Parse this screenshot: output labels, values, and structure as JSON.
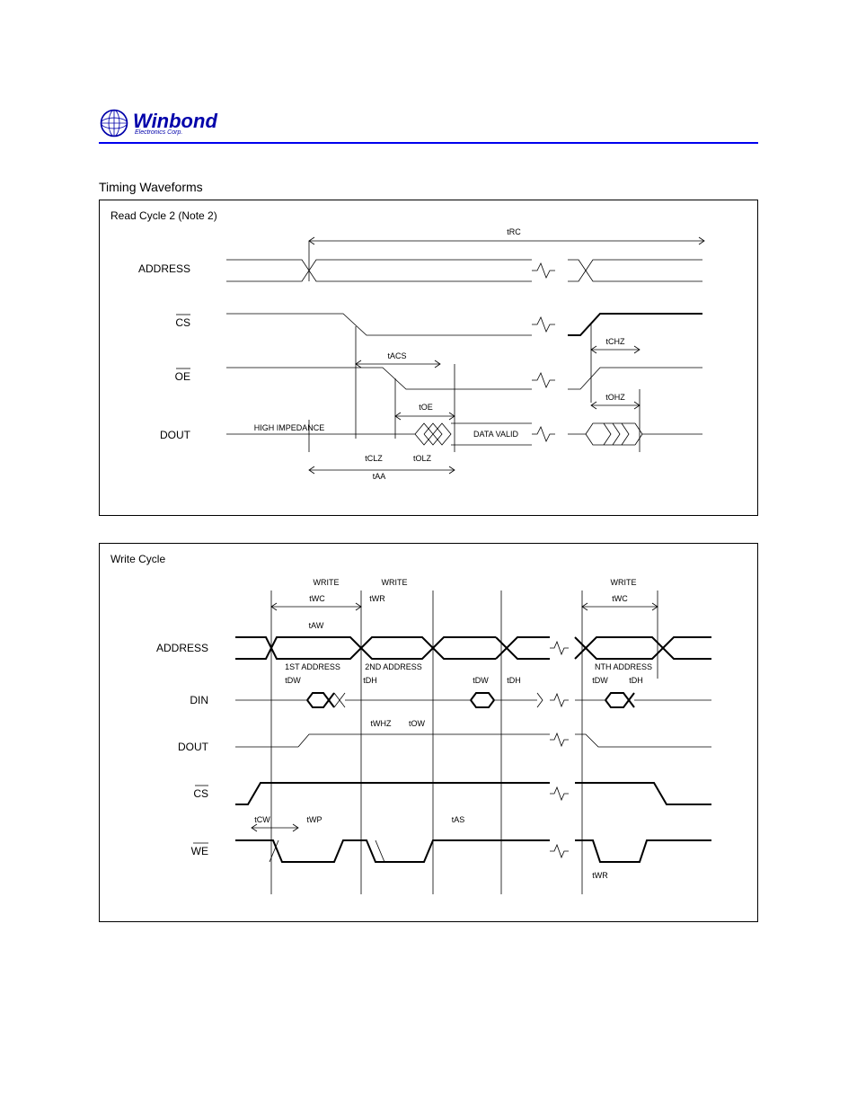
{
  "header": {
    "logo_main": "Winbond",
    "logo_sub": "Electronics Corp."
  },
  "diagram1": {
    "section": "Timing Waveforms",
    "title": "Read Cycle 2 (Note 2)",
    "signals": {
      "addr": "ADDRESS",
      "cs": "CS",
      "oe": "OE",
      "dout": "DOUT"
    },
    "timings": {
      "tRC": "tRC",
      "tACS": "tACS",
      "tOE": "tOE",
      "tCLZ": "tCLZ",
      "tOLZ": "tOLZ",
      "tAA": "tAA",
      "tCHZ": "tCHZ",
      "tOHZ": "tOHZ"
    },
    "values": {
      "hiz": "HIGH IMPEDANCE",
      "valid": "DATA VALID"
    }
  },
  "diagram2": {
    "title": "Write Cycle",
    "signals": {
      "addr": "ADDRESS",
      "din": "DIN",
      "dout": "DOUT",
      "cs": "CS",
      "we": "WE"
    },
    "timings": {
      "tWC": "tWC",
      "tAW": "tAW",
      "tWR": "tWR",
      "tDW": "tDW",
      "tDH": "tDH",
      "tWHZ": "tWHZ",
      "tOW": "tOW",
      "tCW": "tCW",
      "tWP": "tWP",
      "tAS": "tAS"
    },
    "labels": {
      "wr1": "WRITE",
      "wr2": "WRITE",
      "wrn": "WRITE",
      "addr1": "1ST ADDRESS",
      "addr2": "2ND ADDRESS",
      "addrn": "NTH ADDRESS"
    }
  }
}
